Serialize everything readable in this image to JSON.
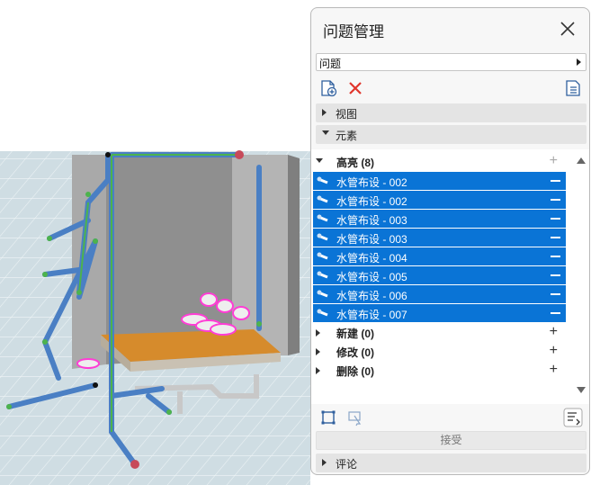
{
  "panel": {
    "title": "问题管理",
    "dropdown_value": "问题",
    "sections": {
      "view_label": "视图",
      "elements_label": "元素",
      "comments_label": "评论"
    },
    "groups": {
      "highlight": {
        "label": "高亮",
        "count": "(8)"
      },
      "new": {
        "label": "新建",
        "count": "(0)"
      },
      "modified": {
        "label": "修改",
        "count": "(0)"
      },
      "deleted": {
        "label": "删除",
        "count": "(0)"
      }
    },
    "items": [
      {
        "label": "水管布设 - 002"
      },
      {
        "label": "水管布设 - 002"
      },
      {
        "label": "水管布设 - 003"
      },
      {
        "label": "水管布设 - 003"
      },
      {
        "label": "水管布设 - 004"
      },
      {
        "label": "水管布设 - 005"
      },
      {
        "label": "水管布设 - 006"
      },
      {
        "label": "水管布设 - 007"
      }
    ],
    "accept_label": "接受",
    "plus_symbol": "+",
    "colors": {
      "selection": "#0a74d6",
      "pipe": "#4a7fc4",
      "highlight": "#ff3dd5"
    }
  }
}
